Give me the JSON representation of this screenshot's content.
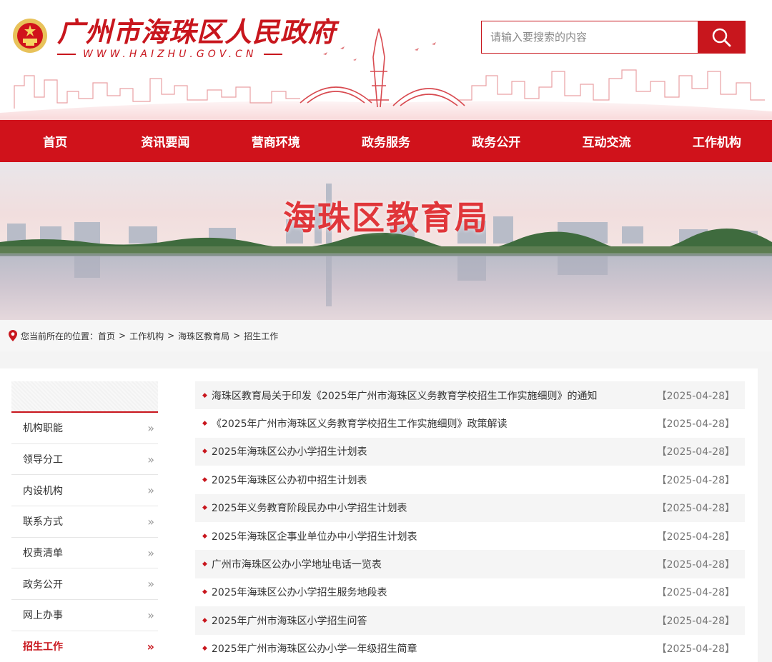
{
  "header": {
    "site_title": "广州市海珠区人民政府",
    "site_url": "WWW.HAIZHU.GOV.CN",
    "search_placeholder": "请输入要搜索的内容"
  },
  "nav": {
    "items": [
      {
        "label": "首页"
      },
      {
        "label": "资讯要闻"
      },
      {
        "label": "营商环境"
      },
      {
        "label": "政务服务"
      },
      {
        "label": "政务公开"
      },
      {
        "label": "互动交流"
      },
      {
        "label": "工作机构"
      }
    ]
  },
  "banner": {
    "title": "海珠区教育局"
  },
  "breadcrumb": {
    "prefix": "您当前所在的位置：",
    "items": [
      "首页",
      "工作机构",
      "海珠区教育局",
      "招生工作"
    ],
    "separator": ">"
  },
  "sidebar": {
    "arrow": "»",
    "items": [
      {
        "label": "机构职能"
      },
      {
        "label": "领导分工"
      },
      {
        "label": "内设机构"
      },
      {
        "label": "联系方式"
      },
      {
        "label": "权责清单"
      },
      {
        "label": "政务公开"
      },
      {
        "label": "网上办事"
      },
      {
        "label": "招生工作",
        "active": true
      }
    ]
  },
  "articles": {
    "bullet": "◆",
    "items": [
      {
        "title": "海珠区教育局关于印发《2025年广州市海珠区义务教育学校招生工作实施细则》的通知",
        "date": "【2025-04-28】"
      },
      {
        "title": "《2025年广州市海珠区义务教育学校招生工作实施细则》政策解读",
        "date": "【2025-04-28】"
      },
      {
        "title": "2025年海珠区公办小学招生计划表",
        "date": "【2025-04-28】"
      },
      {
        "title": "2025年海珠区公办初中招生计划表",
        "date": "【2025-04-28】"
      },
      {
        "title": "2025年义务教育阶段民办中小学招生计划表",
        "date": "【2025-04-28】"
      },
      {
        "title": "2025年海珠区企事业单位办中小学招生计划表",
        "date": "【2025-04-28】"
      },
      {
        "title": "广州市海珠区公办小学地址电话一览表",
        "date": "【2025-04-28】"
      },
      {
        "title": "2025年海珠区公办小学招生服务地段表",
        "date": "【2025-04-28】"
      },
      {
        "title": "2025年广州市海珠区小学招生问答",
        "date": "【2025-04-28】"
      },
      {
        "title": "2025年广州市海珠区公办小学一年级招生简章",
        "date": "【2025-04-28】"
      }
    ]
  },
  "colors": {
    "brand_red": "#c8161d",
    "nav_red": "#d0121b"
  },
  "icons": {
    "search": "search-icon",
    "location": "location-pin-icon",
    "emblem": "national-emblem-icon",
    "list_arrow": "double-chevron-right-icon"
  }
}
